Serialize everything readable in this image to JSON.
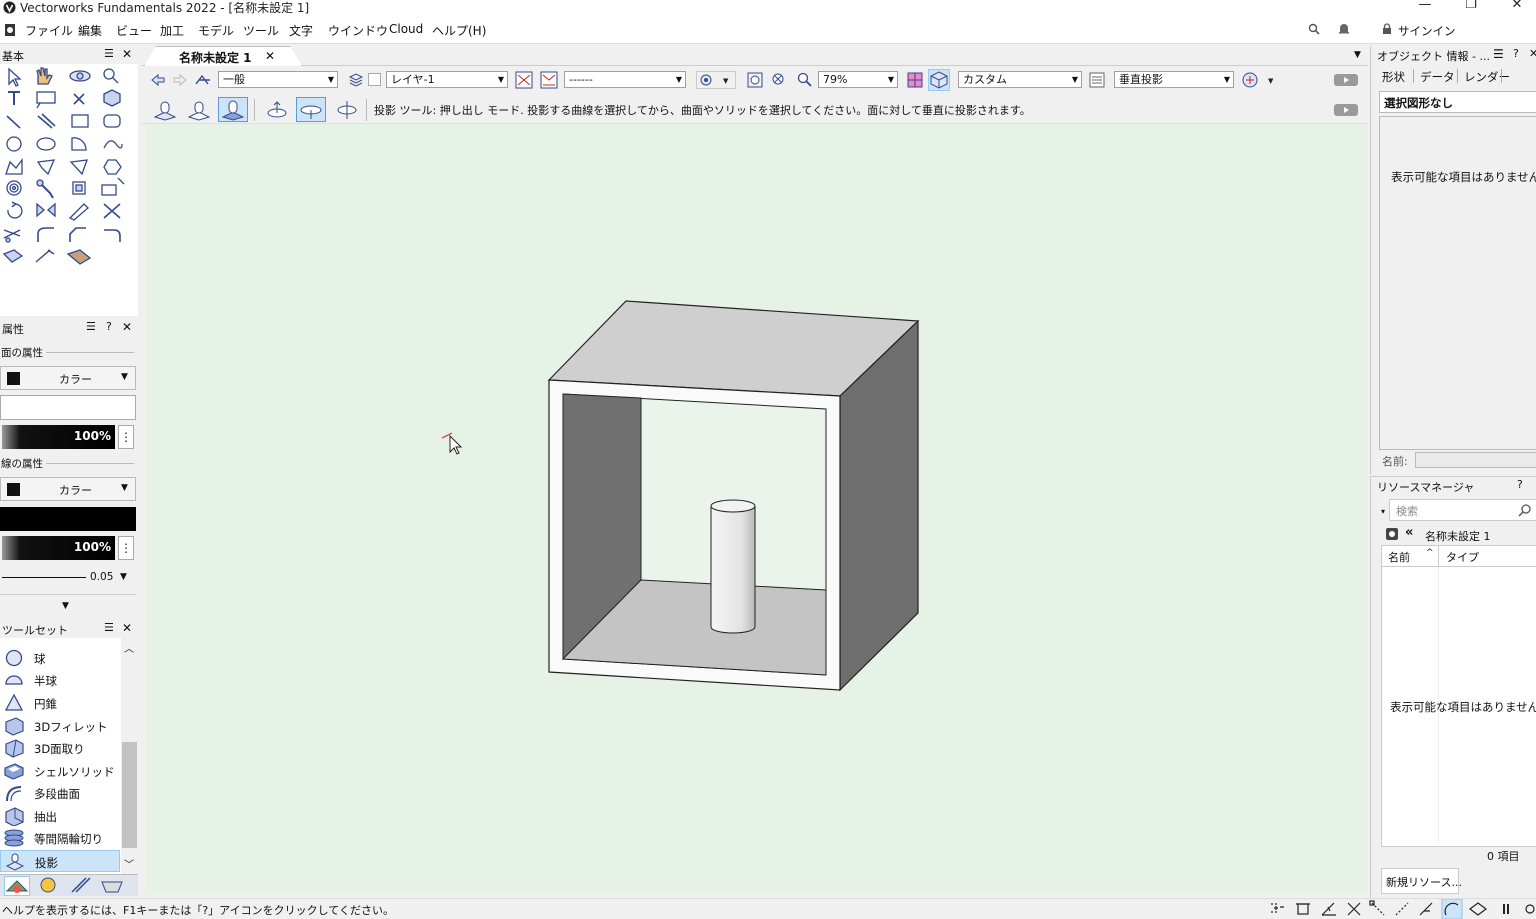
{
  "app": {
    "title": "Vectorworks Fundamentals 2022 - [名称未設定 1]",
    "window_controls": [
      "—",
      "❐",
      "✕"
    ]
  },
  "menu": [
    "ファイル",
    "編集",
    "ビュー",
    "加工",
    "モデル",
    "ツール",
    "文字",
    "ウインドウ",
    "Cloud",
    "ヘルプ(H)"
  ],
  "signin": "サインイン",
  "document_tab": {
    "label": "名称未設定 1",
    "close": "✕"
  },
  "view_bar": {
    "class_value": "一般",
    "layer_value": "レイヤ-1",
    "line_value": "------",
    "zoom_value": "79%",
    "view_value": "カスタム",
    "projection_value": "垂直投影"
  },
  "mode_bar": {
    "help_text": "投影 ツール: 押し出し モード. 投影する曲線を選択してから、曲面やソリッドを選択してください。面に対して垂直に投影されます。"
  },
  "basic_palette": {
    "title": "基本",
    "menu": "☰",
    "close": "✕"
  },
  "attributes": {
    "title": "属性",
    "help": "?",
    "face_section": "面の属性",
    "face_fill_type": "カラー",
    "face_opacity": "100%",
    "line_section": "線の属性",
    "line_fill_type": "カラー",
    "line_opacity": "100%",
    "line_thickness": "0.05"
  },
  "toolset": {
    "title": "ツールセット",
    "items": [
      {
        "label": "球",
        "selected": false
      },
      {
        "label": "半球",
        "selected": false
      },
      {
        "label": "円錐",
        "selected": false
      },
      {
        "label": "3Dフィレット",
        "selected": false
      },
      {
        "label": "3D面取り",
        "selected": false
      },
      {
        "label": "シェルソリッド",
        "selected": false
      },
      {
        "label": "多段曲面",
        "selected": false
      },
      {
        "label": "抽出",
        "selected": false
      },
      {
        "label": "等間隔輪切り",
        "selected": false
      },
      {
        "label": "投影",
        "selected": true
      }
    ]
  },
  "obj_info": {
    "title": "オブジェクト 情報 - ...",
    "tabs": [
      "形状",
      "データ",
      "レンダー"
    ],
    "selection": "選択図形なし",
    "empty": "表示可能な項目はありません",
    "name_label": "名前:"
  },
  "resource_manager": {
    "title": "リソースマネージャ",
    "search_placeholder": "検索",
    "file": "名称未設定 1",
    "back_symbol": "«",
    "col_name": "名前",
    "col_type": "タイプ",
    "empty": "表示可能な項目はありません",
    "count": "0 項目",
    "new_button": "新規リソース..."
  },
  "status_text": "ヘルプを表示するには、F1キーまたは「?」アイコンをクリックしてください。",
  "colors": {
    "canvas_bg": "#e7f2e7",
    "selected_tool": "#cce4f7",
    "tool_stroke": "#334a8c"
  }
}
